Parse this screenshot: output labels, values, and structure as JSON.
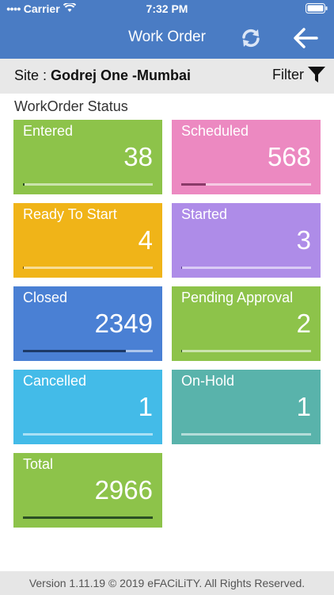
{
  "status_bar": {
    "carrier": "Carrier",
    "time": "7:32 PM"
  },
  "header": {
    "title": "Work Order"
  },
  "site": {
    "label": "Site : ",
    "name": "Godrej One -Mumbai",
    "filter_label": "Filter"
  },
  "section_title": "WorkOrder Status",
  "tiles": [
    {
      "label": "Entered",
      "value": "38",
      "color": "#8dc34a",
      "fill_fraction": 0.013,
      "fill_color": "#2b4f24"
    },
    {
      "label": "Scheduled",
      "value": "568",
      "color": "#ec89c1",
      "fill_fraction": 0.191,
      "fill_color": "#8a3a69"
    },
    {
      "label": "Ready To Start",
      "value": "4",
      "color": "#f0b418",
      "fill_fraction": 0.001,
      "fill_color": "#6b4c00"
    },
    {
      "label": "Started",
      "value": "3",
      "color": "#ae8ce8",
      "fill_fraction": 0.001,
      "fill_color": "#5a3f8d"
    },
    {
      "label": "Closed",
      "value": "2349",
      "color": "#4a80d4",
      "fill_fraction": 0.792,
      "fill_color": "#1d3a68"
    },
    {
      "label": "Pending Approval",
      "value": "2",
      "color": "#8dc34a",
      "fill_fraction": 0.001,
      "fill_color": "#2b4f24"
    },
    {
      "label": "Cancelled",
      "value": "1",
      "color": "#43bbe8",
      "fill_fraction": 0.0,
      "fill_color": "#1c5b74"
    },
    {
      "label": "On-Hold",
      "value": "1",
      "color": "#59b3ab",
      "fill_fraction": 0.0,
      "fill_color": "#21504b"
    },
    {
      "label": "Total",
      "value": "2966",
      "color": "#8dc34a",
      "fill_fraction": 1.0,
      "fill_color": "#2b4f24"
    }
  ],
  "footer": {
    "text": "Version 1.11.19 © 2019 eFACiLiTY. All Rights Reserved."
  },
  "icons": {
    "refresh": "refresh-icon",
    "back": "arrow-left-icon",
    "filter": "funnel-icon",
    "wifi": "wifi-icon",
    "battery": "battery-icon"
  },
  "colors": {
    "header_bg": "#4a7cc4",
    "sitebar_bg": "#e8e8e8",
    "footer_bg": "#e6e6e6"
  }
}
